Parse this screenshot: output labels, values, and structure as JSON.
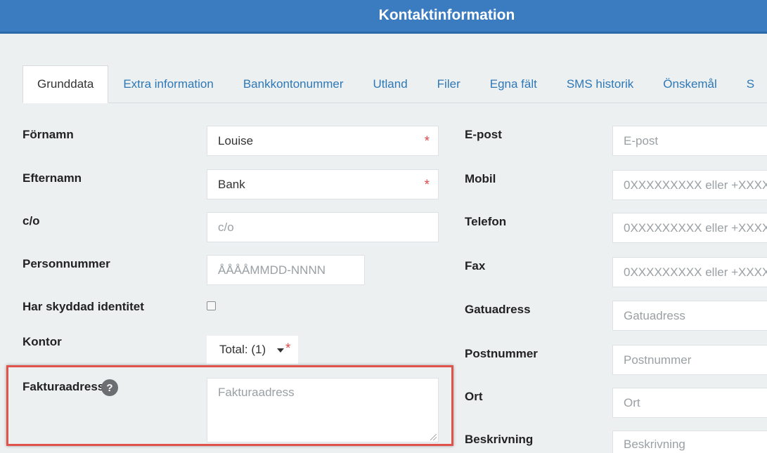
{
  "header": {
    "title": "Kontaktinformation"
  },
  "tabs": [
    {
      "label": "Grunddata",
      "active": true
    },
    {
      "label": "Extra information"
    },
    {
      "label": "Bankkontonummer"
    },
    {
      "label": "Utland"
    },
    {
      "label": "Filer"
    },
    {
      "label": "Egna fält"
    },
    {
      "label": "SMS historik"
    },
    {
      "label": "Önskemål"
    },
    {
      "label": "S"
    }
  ],
  "left": {
    "fornamn": {
      "label": "Förnamn",
      "value": "Louise",
      "required": "*"
    },
    "efternamn": {
      "label": "Efternamn",
      "value": "Bank",
      "required": "*"
    },
    "co": {
      "label": "c/o",
      "placeholder": "c/o"
    },
    "personnummer": {
      "label": "Personnummer",
      "placeholder": "ÅÅÅÅMMDD-NNNN"
    },
    "skyddad": {
      "label": "Har skyddad identitet"
    },
    "kontor": {
      "label": "Kontor",
      "value": "Total: (1)",
      "required": "*"
    },
    "faktura": {
      "label": "Fakturaadress",
      "help": "?",
      "placeholder": "Fakturaadress"
    }
  },
  "right": {
    "epost": {
      "label": "E-post",
      "placeholder": "E-post"
    },
    "mobil": {
      "label": "Mobil",
      "placeholder": "0XXXXXXXXX eller +XXXX"
    },
    "telefon": {
      "label": "Telefon",
      "placeholder": "0XXXXXXXXX eller +XXXX"
    },
    "fax": {
      "label": "Fax",
      "placeholder": "0XXXXXXXXX eller +XXXX"
    },
    "gatuadress": {
      "label": "Gatuadress",
      "placeholder": "Gatuadress"
    },
    "postnummer": {
      "label": "Postnummer",
      "placeholder": "Postnummer"
    },
    "ort": {
      "label": "Ort",
      "placeholder": "Ort"
    },
    "beskrivning": {
      "label": "Beskrivning",
      "placeholder": "Beskrivning"
    }
  },
  "colors": {
    "header": "#3b7bbf",
    "highlight": "#e0524a",
    "required": "#e04a4a",
    "link": "#2f78b6"
  }
}
